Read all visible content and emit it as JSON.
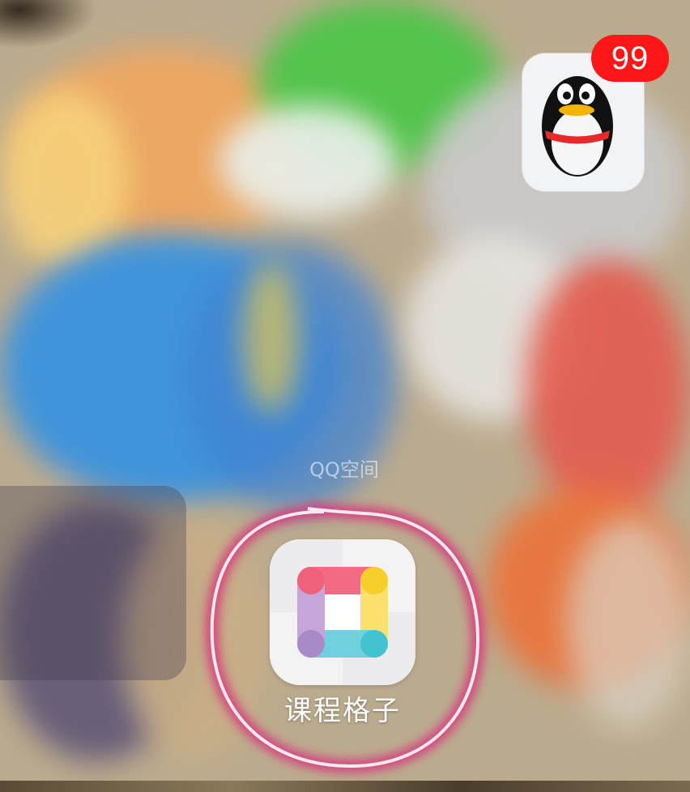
{
  "home_screen": {
    "qq_app": {
      "icon": "qq-penguin-icon",
      "badge_count": "99",
      "label": "QQ空间"
    },
    "course_app": {
      "icon": "course-grid-icon",
      "label": "课程格子"
    },
    "colors": {
      "badge": "#ff1616",
      "annotation_circle": "#d9327a"
    }
  }
}
